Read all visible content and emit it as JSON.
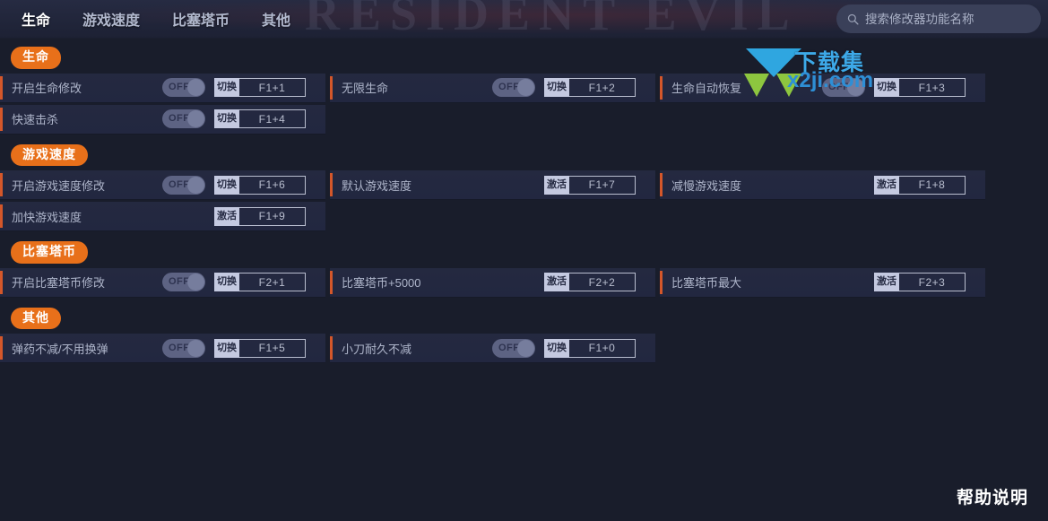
{
  "header": {
    "ghost_title": "RESIDENT EVIL",
    "tabs": [
      {
        "label": "生命",
        "active": true
      },
      {
        "label": "游戏速度",
        "active": false
      },
      {
        "label": "比塞塔币",
        "active": false
      },
      {
        "label": "其他",
        "active": false
      }
    ],
    "search": {
      "icon": "search-icon",
      "placeholder": "搜索修改器功能名称",
      "value": ""
    }
  },
  "sections": [
    {
      "title": "生命",
      "rows": [
        {
          "label": "开启生命修改",
          "toggle": "OFF",
          "has_toggle": true,
          "action": "切换",
          "hotkey": "F1+1"
        },
        {
          "label": "无限生命",
          "toggle": "OFF",
          "has_toggle": true,
          "action": "切换",
          "hotkey": "F1+2"
        },
        {
          "label": "生命自动恢复",
          "toggle": "OFF",
          "has_toggle": true,
          "action": "切换",
          "hotkey": "F1+3"
        },
        {
          "label": "快速击杀",
          "toggle": "OFF",
          "has_toggle": true,
          "action": "切换",
          "hotkey": "F1+4"
        }
      ]
    },
    {
      "title": "游戏速度",
      "rows": [
        {
          "label": "开启游戏速度修改",
          "toggle": "OFF",
          "has_toggle": true,
          "action": "切换",
          "hotkey": "F1+6"
        },
        {
          "label": "默认游戏速度",
          "toggle": "",
          "has_toggle": false,
          "action": "激活",
          "hotkey": "F1+7"
        },
        {
          "label": "减慢游戏速度",
          "toggle": "",
          "has_toggle": false,
          "action": "激活",
          "hotkey": "F1+8"
        },
        {
          "label": "加快游戏速度",
          "toggle": "",
          "has_toggle": false,
          "action": "激活",
          "hotkey": "F1+9"
        }
      ]
    },
    {
      "title": "比塞塔币",
      "rows": [
        {
          "label": "开启比塞塔币修改",
          "toggle": "OFF",
          "has_toggle": true,
          "action": "切换",
          "hotkey": "F2+1"
        },
        {
          "label": "比塞塔币+5000",
          "toggle": "",
          "has_toggle": false,
          "action": "激活",
          "hotkey": "F2+2"
        },
        {
          "label": "比塞塔币最大",
          "toggle": "",
          "has_toggle": false,
          "action": "激活",
          "hotkey": "F2+3"
        }
      ]
    },
    {
      "title": "其他",
      "rows": [
        {
          "label": "弹药不减/不用换弹",
          "toggle": "OFF",
          "has_toggle": true,
          "action": "切换",
          "hotkey": "F1+5"
        },
        {
          "label": "小刀耐久不减",
          "toggle": "OFF",
          "has_toggle": true,
          "action": "切换",
          "hotkey": "F1+0"
        }
      ]
    }
  ],
  "watermark": {
    "text_top": "下载集",
    "text_bottom": "x2ji.com"
  },
  "footer": {
    "help_label": "帮助说明"
  },
  "colors": {
    "accent_orange": "#e8701a",
    "row_accent": "#d4572a",
    "page_bg": "#191d2b",
    "row_bg": "#242940",
    "hotkey_action_bg": "#c4c9e0"
  }
}
